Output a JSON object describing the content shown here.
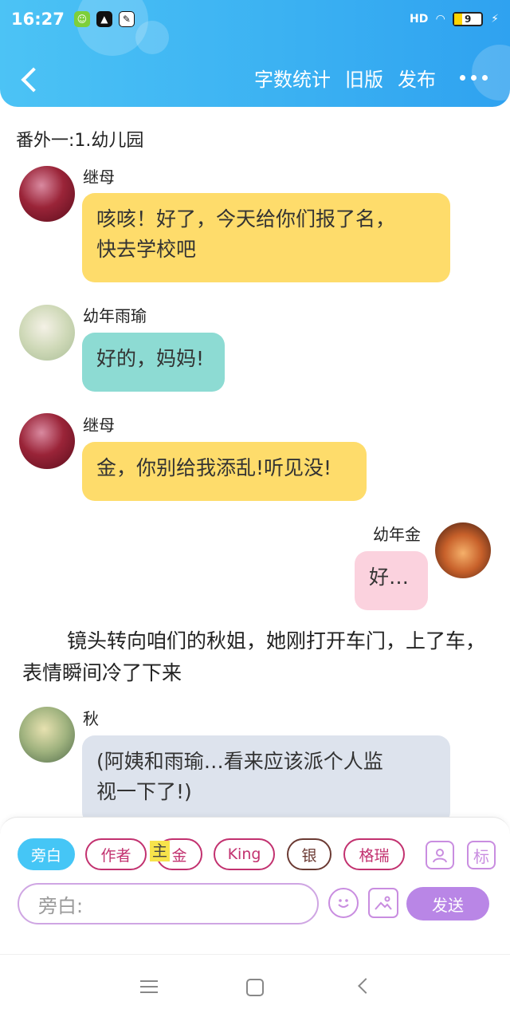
{
  "status_bar": {
    "time": "16:27",
    "signal": "HD",
    "battery": "9"
  },
  "header": {
    "actions": [
      "字数统计",
      "旧版",
      "发布"
    ]
  },
  "chapter_title": "番外一:1.幼儿园",
  "messages": [
    {
      "name": "继母",
      "text_lines": [
        "咳咳！好了，今天给你们报了名，",
        "快去学校吧"
      ],
      "color": "#fedc6b"
    },
    {
      "name": "幼年雨瑜",
      "text_lines": [
        "好的，妈妈!"
      ],
      "color": "#8ddbd3"
    },
    {
      "name": "继母",
      "text_lines": [
        "金，你别给我添乱!听见没!"
      ],
      "color": "#fedc6b"
    },
    {
      "name": "幼年金",
      "text_lines": [
        "好…"
      ],
      "color": "#fbd2de"
    },
    {
      "name": "秋",
      "text_lines": [
        "(阿姨和雨瑜…看来应该派个人监",
        "视一下了!)"
      ],
      "color": "#dde3ed"
    }
  ],
  "narration": "镜头转向咱们的秋姐，她刚打开车门，上了车，表情瞬间冷了下来",
  "panel": {
    "chips": [
      "旁白",
      "作者",
      "金",
      "King",
      "银",
      "格瑞"
    ],
    "main_tag": "主",
    "side_icons": [
      "person-icon",
      "标"
    ],
    "input_placeholder": "旁白:",
    "send_label": "发送"
  },
  "colors": {
    "header_blue": "#3ab0f2",
    "chip_active": "#45c6f6",
    "send_purple": "#b986e6"
  }
}
